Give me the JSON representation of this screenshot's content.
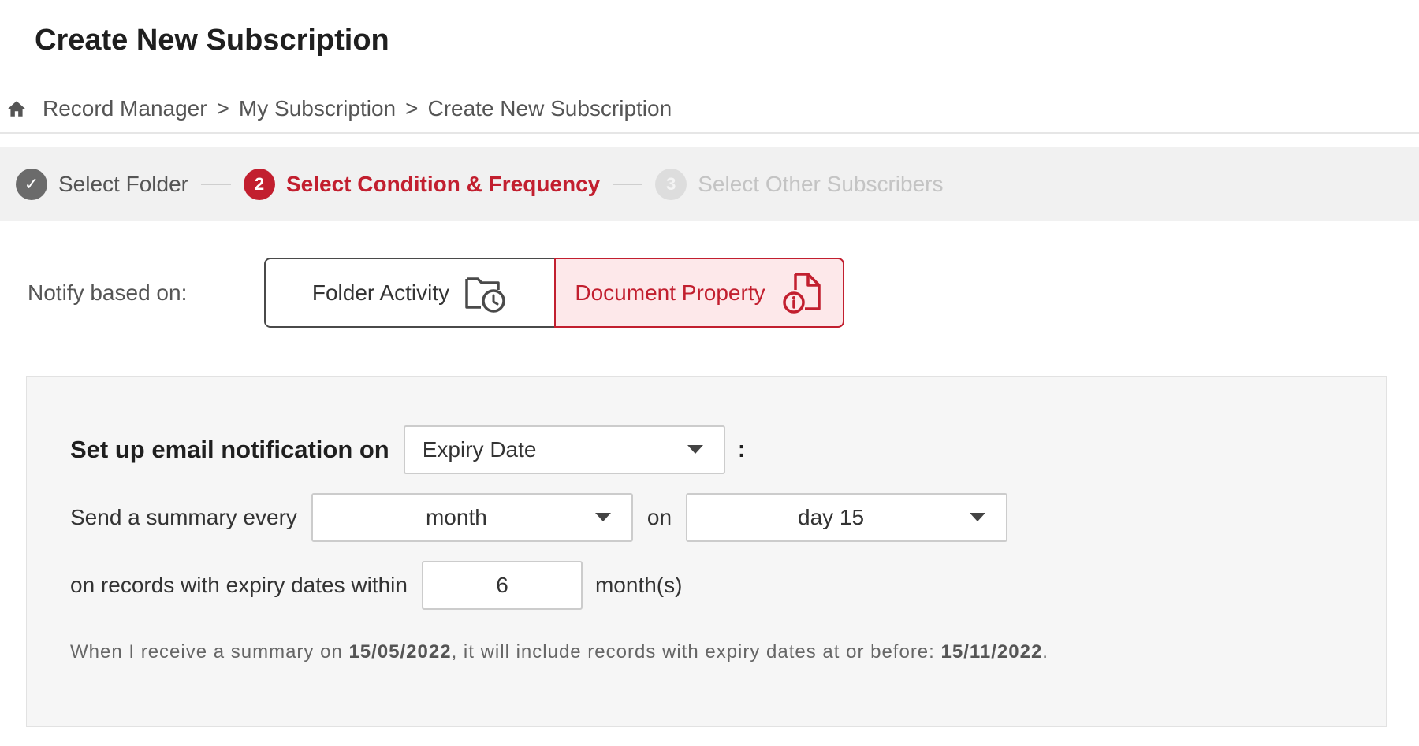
{
  "page": {
    "title": "Create New Subscription"
  },
  "breadcrumb": {
    "items": [
      "Record Manager",
      "My Subscription",
      "Create New Subscription"
    ],
    "separator": ">"
  },
  "stepper": {
    "steps": [
      {
        "number": "✓",
        "label": "Select Folder",
        "state": "done"
      },
      {
        "number": "2",
        "label": "Select Condition & Frequency",
        "state": "active"
      },
      {
        "number": "3",
        "label": "Select Other Subscribers",
        "state": "pending"
      }
    ]
  },
  "notify": {
    "label": "Notify based on:",
    "options": [
      {
        "label": "Folder Activity",
        "icon": "folder-clock-icon",
        "selected": false
      },
      {
        "label": "Document Property",
        "icon": "document-info-icon",
        "selected": true
      }
    ]
  },
  "form": {
    "heading": "Set up email notification on",
    "property_value": "Expiry Date",
    "colon": ":",
    "summary_label": "Send a summary every",
    "period_value": "month",
    "on_label": "on",
    "day_value": "day 15",
    "within_label": "on records with expiry dates within",
    "within_value": "6",
    "within_unit": "month(s)",
    "note": {
      "prefix": "When I receive a summary on ",
      "date1": "15/05/2022",
      "middle": ", it will include records with expiry dates at or before: ",
      "date2": "15/11/2022",
      "suffix": "."
    }
  },
  "colors": {
    "accent": "#c21f2f",
    "accent_bg": "#fde8ea",
    "stepper_bg": "#f1f1f1",
    "panel_bg": "#f6f6f6"
  }
}
